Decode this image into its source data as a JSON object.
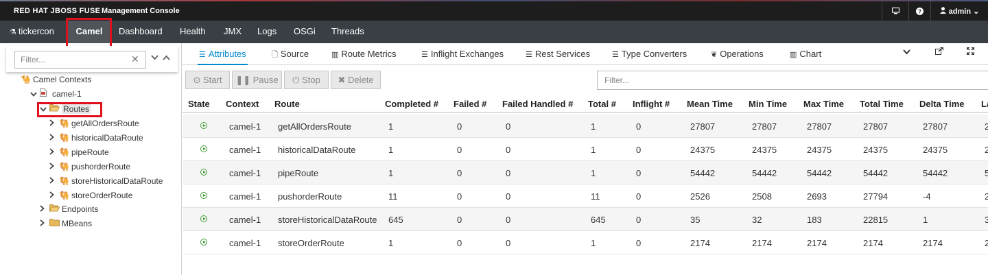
{
  "brand": {
    "name": "RED HAT JBOSS FUSE",
    "subtitle": "Management Console"
  },
  "topbar": {
    "user": "admin ⌄"
  },
  "nav": {
    "app_label": "tickercon",
    "items": [
      "Camel",
      "Dashboard",
      "Health",
      "JMX",
      "Logs",
      "OSGi",
      "Threads"
    ]
  },
  "leftpane": {
    "filter_placeholder": "Filter...",
    "tree": {
      "root": "Camel Contexts",
      "context": "camel-1",
      "routes_label": "Routes",
      "routes": [
        "getAllOrdersRoute",
        "historicalDataRoute",
        "pipeRoute",
        "pushorderRoute",
        "storeHistoricalDataRoute",
        "storeOrderRoute"
      ],
      "endpoints": "Endpoints",
      "mbeans": "MBeans"
    }
  },
  "tabs": [
    "Attributes",
    "Source",
    "Route Metrics",
    "Inflight Exchanges",
    "Rest Services",
    "Type Converters",
    "Operations",
    "Chart"
  ],
  "toolbar": {
    "start": "Start",
    "pause": "Pause",
    "stop": "Stop",
    "delete": "Delete",
    "filter_placeholder": "Filter..."
  },
  "table": {
    "headers": [
      "State",
      "Context",
      "Route",
      "Completed #",
      "Failed #",
      "Failed Handled #",
      "Total #",
      "Inflight #",
      "Mean Time",
      "Min Time",
      "Max Time",
      "Total Time",
      "Delta Time",
      "La"
    ],
    "rows": [
      [
        "camel-1",
        "getAllOrdersRoute",
        "1",
        "0",
        "0",
        "1",
        "0",
        "27807",
        "27807",
        "27807",
        "27807",
        "27807",
        "2"
      ],
      [
        "camel-1",
        "historicalDataRoute",
        "1",
        "0",
        "0",
        "1",
        "0",
        "24375",
        "24375",
        "24375",
        "24375",
        "24375",
        "2"
      ],
      [
        "camel-1",
        "pipeRoute",
        "1",
        "0",
        "0",
        "1",
        "0",
        "54442",
        "54442",
        "54442",
        "54442",
        "54442",
        "5"
      ],
      [
        "camel-1",
        "pushorderRoute",
        "11",
        "0",
        "0",
        "11",
        "0",
        "2526",
        "2508",
        "2693",
        "27794",
        "-4",
        "2"
      ],
      [
        "camel-1",
        "storeHistoricalDataRoute",
        "645",
        "0",
        "0",
        "645",
        "0",
        "35",
        "32",
        "183",
        "22815",
        "1",
        "3"
      ],
      [
        "camel-1",
        "storeOrderRoute",
        "1",
        "0",
        "0",
        "1",
        "0",
        "2174",
        "2174",
        "2174",
        "2174",
        "2174",
        "2"
      ]
    ]
  },
  "colors": {
    "accent": "#0088ce",
    "highlight": "#e0101d",
    "running": "#3f9c35",
    "navbar": "#393f44"
  }
}
